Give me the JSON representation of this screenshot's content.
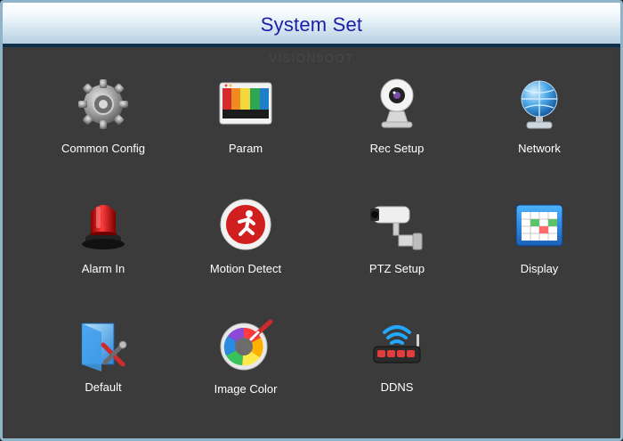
{
  "window": {
    "title": "System Set",
    "watermark": "VISION9OOT"
  },
  "menu": {
    "items": [
      {
        "label": "Common Config",
        "icon": "gear-icon"
      },
      {
        "label": "Param",
        "icon": "color-bars-icon"
      },
      {
        "label": "Rec Setup",
        "icon": "webcam-icon"
      },
      {
        "label": "Network",
        "icon": "globe-icon"
      },
      {
        "label": "Alarm In",
        "icon": "alarm-light-icon"
      },
      {
        "label": "Motion Detect",
        "icon": "running-man-icon"
      },
      {
        "label": "PTZ Setup",
        "icon": "security-camera-icon"
      },
      {
        "label": "Display",
        "icon": "spreadsheet-window-icon"
      },
      {
        "label": "Default",
        "icon": "folder-tools-icon"
      },
      {
        "label": "Image Color",
        "icon": "color-wheel-brush-icon"
      },
      {
        "label": "DDNS",
        "icon": "router-wifi-icon"
      }
    ]
  },
  "colors": {
    "title_text": "#1b1fa8",
    "background": "#3b3b3b",
    "label_text": "#ffffff",
    "frame_border": "#8fb3c9"
  }
}
